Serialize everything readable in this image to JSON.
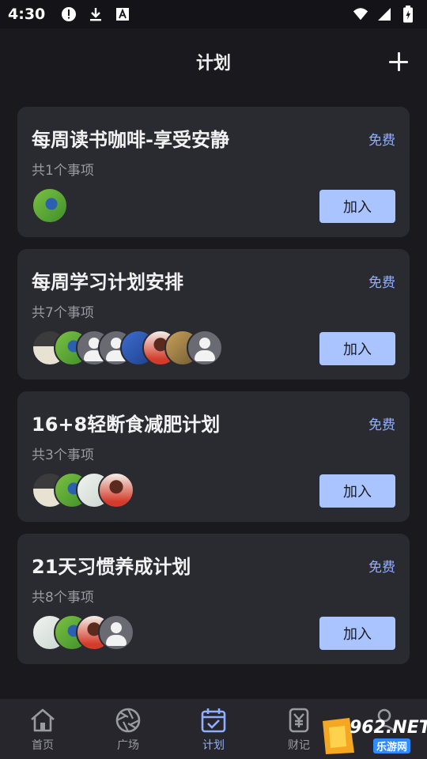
{
  "status_bar": {
    "time": "4:30"
  },
  "header": {
    "title": "计划"
  },
  "plans": [
    {
      "title": "每周读书咖啡-享受安静",
      "price": "免费",
      "count": "共1个事项",
      "join_label": "加入",
      "avatars": [
        "photo-bird"
      ]
    },
    {
      "title": "每周学习计划安排",
      "price": "免费",
      "count": "共7个事项",
      "join_label": "加入",
      "avatars": [
        "photo-landscape",
        "photo-bird",
        "default",
        "default",
        "photo-blue",
        "photo-portrait",
        "photo-cat",
        "default"
      ]
    },
    {
      "title": "16+8轻断食减肥计划",
      "price": "免费",
      "count": "共3个事项",
      "join_label": "加入",
      "avatars": [
        "photo-landscape",
        "photo-bird",
        "photo-light",
        "photo-portrait"
      ]
    },
    {
      "title": "21天习惯养成计划",
      "price": "免费",
      "count": "共8个事项",
      "join_label": "加入",
      "avatars": [
        "photo-light",
        "photo-bird",
        "photo-portrait",
        "default"
      ]
    }
  ],
  "bottom_nav": [
    {
      "label": "首页",
      "icon": "home-icon",
      "active": false
    },
    {
      "label": "广场",
      "icon": "aperture-icon",
      "active": false
    },
    {
      "label": "计划",
      "icon": "calendar-check-icon",
      "active": true
    },
    {
      "label": "财记",
      "icon": "yen-icon",
      "active": false
    },
    {
      "label": "",
      "icon": "profile-icon",
      "active": false
    }
  ],
  "watermark": {
    "text": "962.NET",
    "sub": "乐游网"
  },
  "colors": {
    "background": "#19191e",
    "card": "#2a2a31",
    "accent": "#8fb0ff",
    "button": "#a9c4ff"
  }
}
